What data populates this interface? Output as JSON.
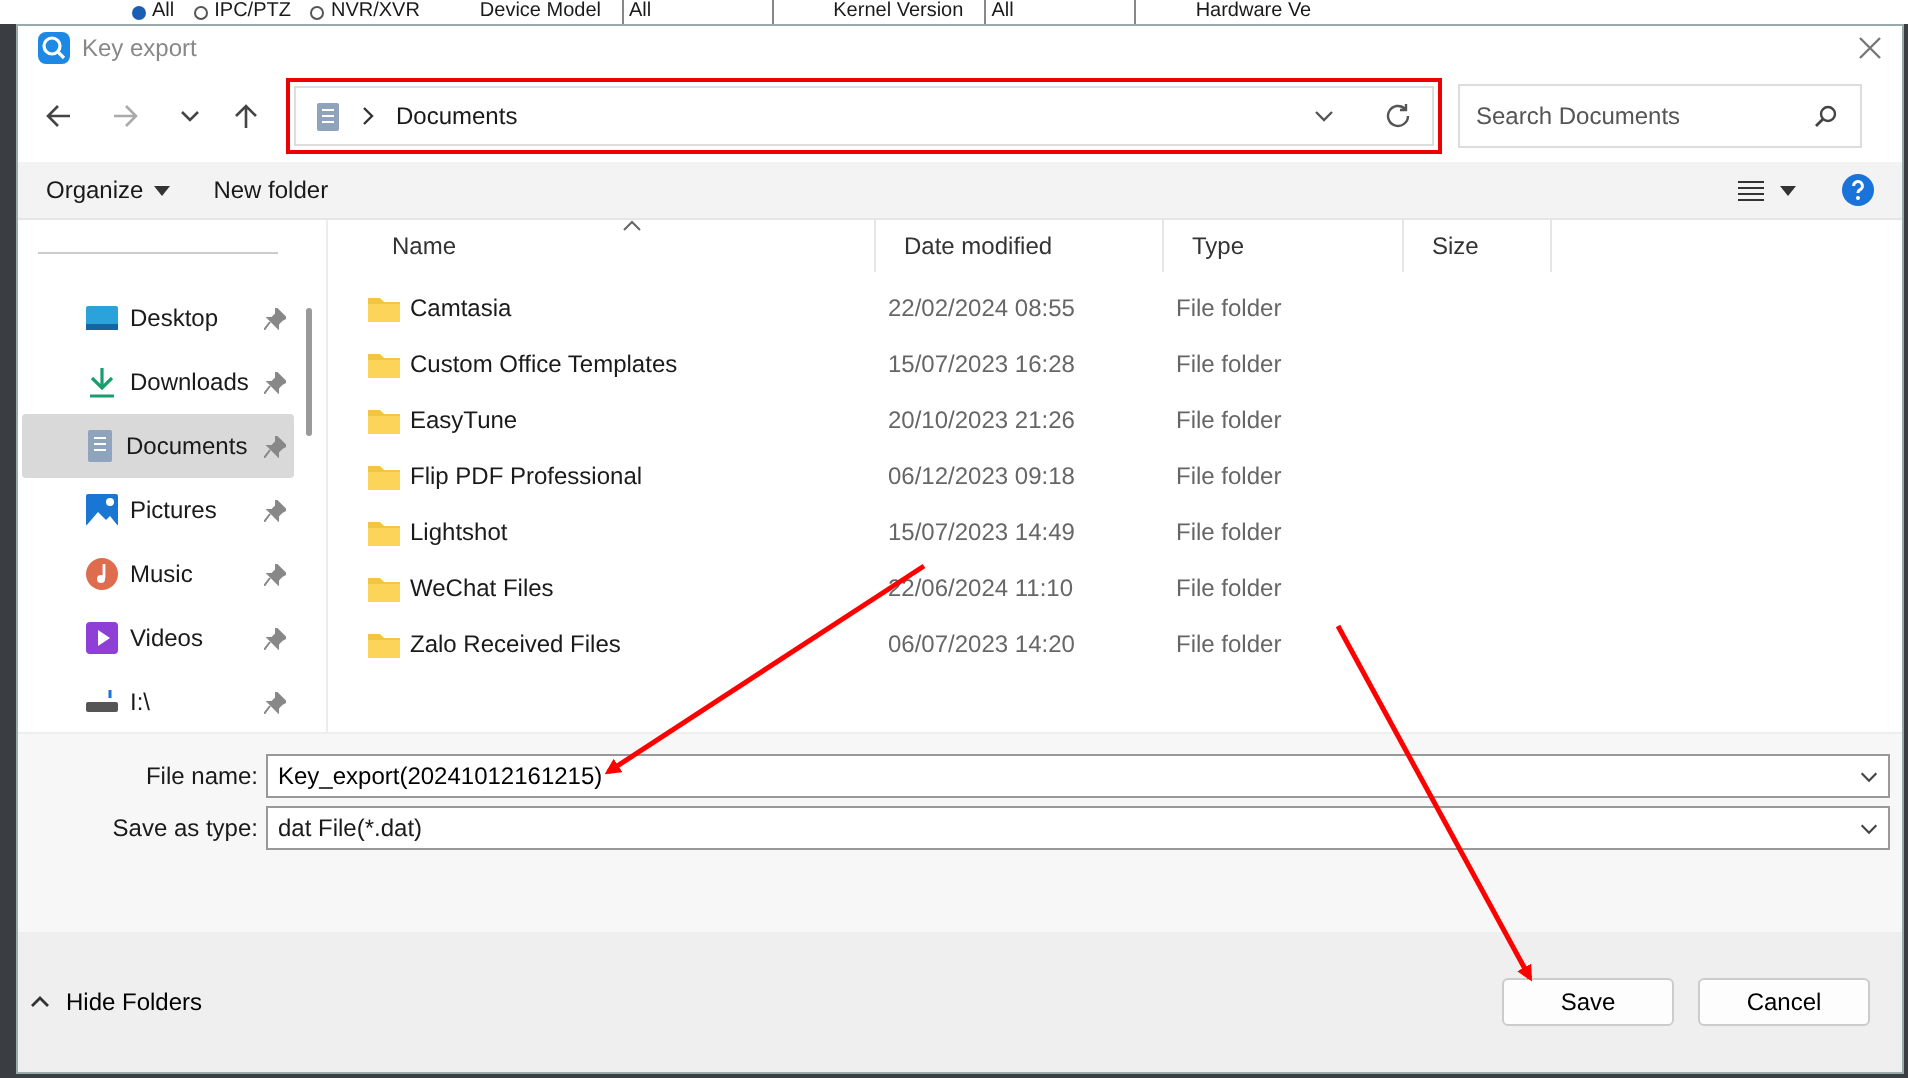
{
  "background_app": {
    "items": [
      {
        "kind": "radio",
        "label": "All",
        "selected": true
      },
      {
        "kind": "radio",
        "label": "IPC/PTZ",
        "selected": false
      },
      {
        "kind": "radio",
        "label": "NVR/XVR",
        "selected": false
      },
      {
        "kind": "label",
        "label": "Device Model"
      },
      {
        "kind": "select",
        "label": "All"
      },
      {
        "kind": "label",
        "label": "Kernel Version"
      },
      {
        "kind": "select",
        "label": "All"
      },
      {
        "kind": "label",
        "label": "Hardware Ve"
      }
    ]
  },
  "window": {
    "title": "Key export"
  },
  "address_bar": {
    "crumb": "Documents",
    "highlighted": true
  },
  "search": {
    "placeholder": "Search Documents"
  },
  "toolbar": {
    "organize": "Organize",
    "new_folder": "New folder"
  },
  "sidebar": {
    "items": [
      {
        "label": "Desktop",
        "selected": false
      },
      {
        "label": "Downloads",
        "selected": false
      },
      {
        "label": "Documents",
        "selected": true
      },
      {
        "label": "Pictures",
        "selected": false
      },
      {
        "label": "Music",
        "selected": false
      },
      {
        "label": "Videos",
        "selected": false
      },
      {
        "label": "I:\\",
        "selected": false
      }
    ]
  },
  "table": {
    "columns": [
      "Name",
      "Date modified",
      "Type",
      "Size"
    ],
    "rows": [
      {
        "name": "Camtasia",
        "date": "22/02/2024 08:55",
        "type": "File folder"
      },
      {
        "name": "Custom Office Templates",
        "date": "15/07/2023 16:28",
        "type": "File folder"
      },
      {
        "name": "EasyTune",
        "date": "20/10/2023 21:26",
        "type": "File folder"
      },
      {
        "name": "Flip PDF Professional",
        "date": "06/12/2023 09:18",
        "type": "File folder"
      },
      {
        "name": "Lightshot",
        "date": "15/07/2023 14:49",
        "type": "File folder"
      },
      {
        "name": "WeChat Files",
        "date": "22/06/2024 11:10",
        "type": "File folder"
      },
      {
        "name": "Zalo Received Files",
        "date": "06/07/2023 14:20",
        "type": "File folder"
      }
    ]
  },
  "file_name": {
    "label": "File name:",
    "value": "Key_export(20241012161215)"
  },
  "save_as_type": {
    "label": "Save as type:",
    "value": "dat File(*.dat)"
  },
  "footer": {
    "hide_folders": "Hide Folders",
    "buttons": [
      "Save",
      "Cancel"
    ]
  }
}
